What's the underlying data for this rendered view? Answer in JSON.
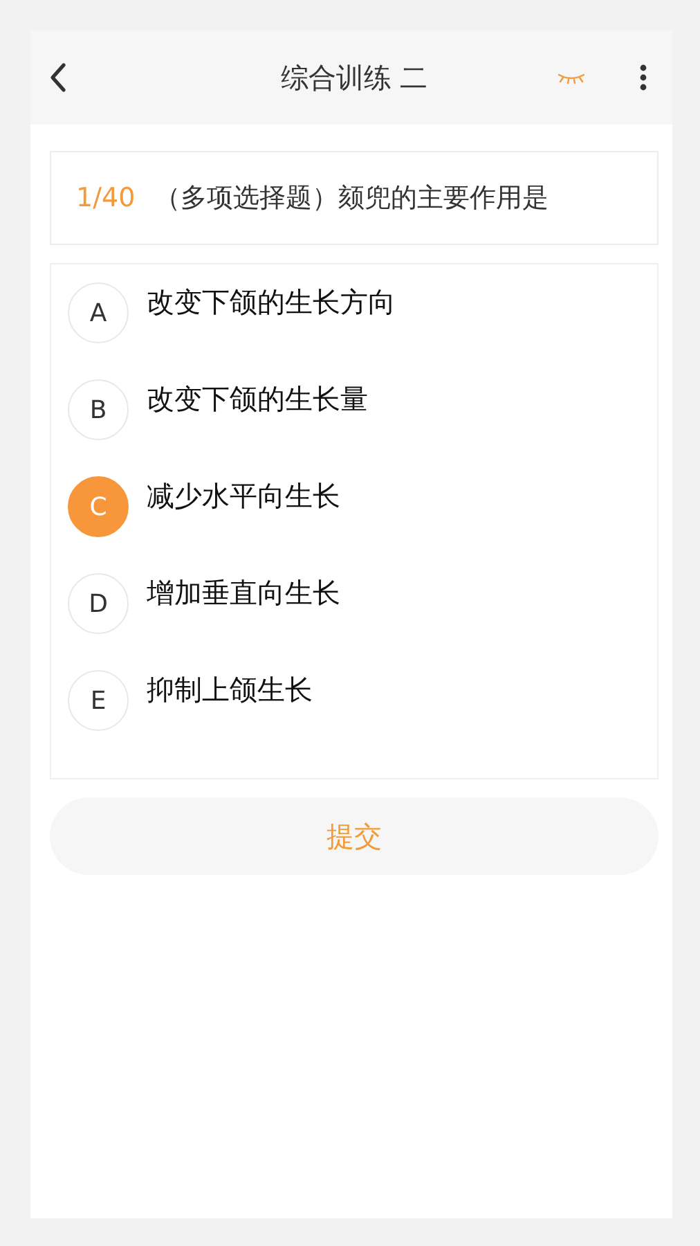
{
  "header": {
    "title": "综合训练 二"
  },
  "question": {
    "progress": "1/40",
    "text": "（多项选择题）颏兜的主要作用是"
  },
  "options": [
    {
      "letter": "A",
      "text": "改变下颌的生长方向",
      "selected": false
    },
    {
      "letter": "B",
      "text": "改变下颌的生长量",
      "selected": false
    },
    {
      "letter": "C",
      "text": "减少水平向生长",
      "selected": true
    },
    {
      "letter": "D",
      "text": "增加垂直向生长",
      "selected": false
    },
    {
      "letter": "E",
      "text": "抑制上颌生长",
      "selected": false
    }
  ],
  "submit": {
    "label": "提交"
  }
}
